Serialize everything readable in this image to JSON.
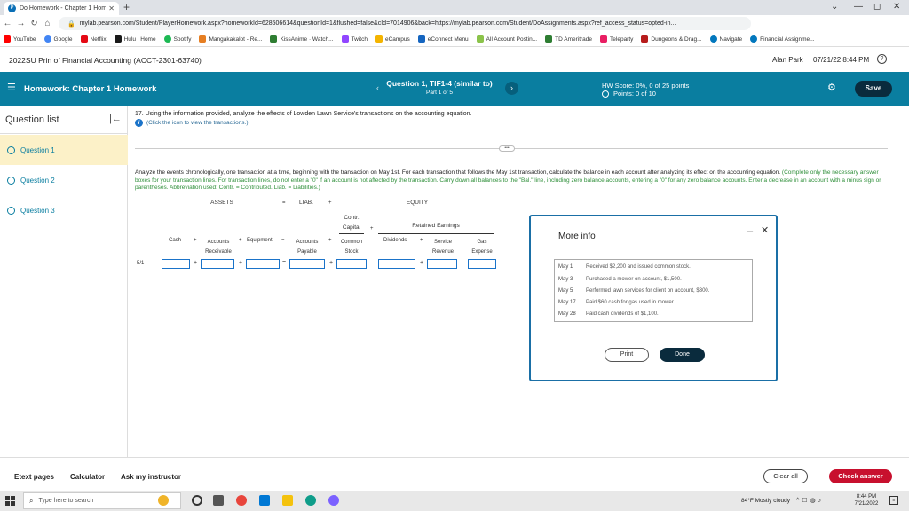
{
  "browser": {
    "tab_title": "Do Homework - Chapter 1 Hom",
    "url": "mylab.pearson.com/Student/PlayerHomework.aspx?homeworkId=628506614&questionId=1&flushed=false&cId=7014906&back=https://mylab.pearson.com/Student/DoAssignments.aspx?ref_access_status=opted-in...",
    "bookmarks": [
      "YouTube",
      "Google",
      "Netflix",
      "Hulu | Home",
      "Spotify",
      "Mangakakalot - Re...",
      "KissAnime · Watch...",
      "Twitch",
      "eCampus",
      "eConnect Menu",
      "All Account Postin...",
      "TD Ameritrade",
      "Teleparty",
      "Dungeons & Drag...",
      "Navigate",
      "Financial Assignme..."
    ]
  },
  "course": {
    "title": "2022SU Prin of Financial Accounting (ACCT-2301-63740)",
    "user": "Alan Park",
    "datetime": "07/21/22 8:44 PM"
  },
  "header": {
    "homework_title": "Homework: Chapter 1 Homework",
    "question_title": "Question 1, TIF1-4 (similar to)",
    "question_part": "Part 1 of 5",
    "hw_score": "HW Score: 0%, 0 of 25 points",
    "points": "Points: 0 of 10",
    "save_label": "Save"
  },
  "sidebar": {
    "title": "Question list",
    "items": [
      {
        "label": "Question 1"
      },
      {
        "label": "Question 2"
      },
      {
        "label": "Question 3"
      }
    ]
  },
  "question": {
    "prompt": "17. Using the information provided, analyze the effects of Lowden Lawn Service's transactions on the accounting equation.",
    "info_link": "(Click the icon to view the transactions.)",
    "instructions_black": "Analyze the events chronologically, one transaction at a time, beginning with the transaction on May 1st. For each transaction that follows the May 1st transaction, calculate the balance in each account after analyzing its effect on the accounting equation.",
    "instructions_green": "(Complete only the necessary answer boxes for your transaction lines. For transaction lines, do not enter a \"0\" if an account is not affected by the transaction. Carry down all balances to the \"Bal.\" line, including zero balance accounts, entering a \"0\" for any zero balance accounts. Enter a decrease in an account with a minus sign or parentheses. Abbreviation used: Contr. = Contributed. Liab. = Liabilities.)"
  },
  "equation": {
    "assets_label": "ASSETS",
    "liab_label": "LIAB.",
    "equity_label": "EQUITY",
    "contr_capital": "Contr. Capital",
    "retained_earnings": "Retained Earnings",
    "columns": {
      "cash": "Cash",
      "accounts_receivable": "Accounts Receivable",
      "equipment": "Equipment",
      "accounts_payable": "Accounts Payable",
      "common_stock": "Common Stock",
      "dividends": "Dividends",
      "service_revenue": "Service Revenue",
      "gas_expense": "Gas Expense"
    },
    "row_date": "5/1"
  },
  "modal": {
    "title": "More info",
    "rows": [
      {
        "date": "May 1",
        "desc": "Received $2,200 and issued common stock."
      },
      {
        "date": "May 3",
        "desc": "Purchased a mower on account, $1,500."
      },
      {
        "date": "May 5",
        "desc": "Performed lawn services for client on account, $300."
      },
      {
        "date": "May 17",
        "desc": "Paid $60 cash for gas used in mower."
      },
      {
        "date": "May 28",
        "desc": "Paid cash dividends of $1,100."
      }
    ],
    "print_label": "Print",
    "done_label": "Done"
  },
  "bottom": {
    "etext": "Etext pages",
    "calculator": "Calculator",
    "ask": "Ask my instructor",
    "clear": "Clear all",
    "check": "Check answer"
  },
  "taskbar": {
    "search_placeholder": "Type here to search",
    "weather": "84°F  Mostly cloudy",
    "time": "8:44 PM",
    "date": "7/21/2022"
  },
  "colors": {
    "teal_header": "#0a7ea0",
    "active_question": "#fcf1c8",
    "check_answer": "#c8102e",
    "dark_button": "#0a2b3d"
  }
}
